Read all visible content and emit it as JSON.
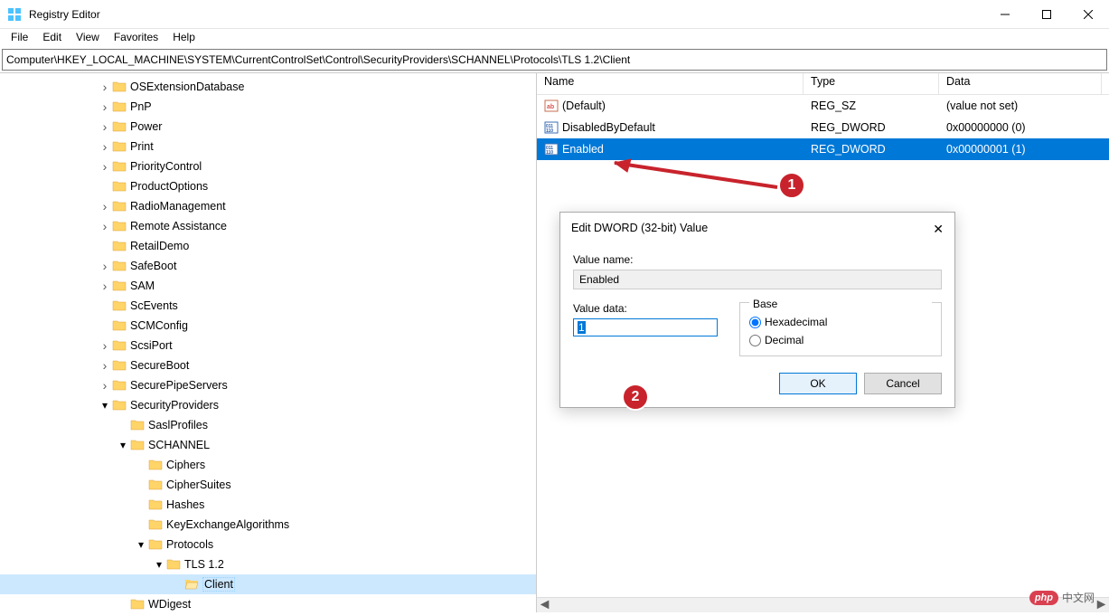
{
  "window": {
    "title": "Registry Editor"
  },
  "menus": [
    "File",
    "Edit",
    "View",
    "Favorites",
    "Help"
  ],
  "address": "Computer\\HKEY_LOCAL_MACHINE\\SYSTEM\\CurrentControlSet\\Control\\SecurityProviders\\SCHANNEL\\Protocols\\TLS 1.2\\Client",
  "tree": {
    "items": [
      {
        "indent": 108,
        "chev": ">",
        "label": "OSExtensionDatabase"
      },
      {
        "indent": 108,
        "chev": ">",
        "label": "PnP"
      },
      {
        "indent": 108,
        "chev": ">",
        "label": "Power"
      },
      {
        "indent": 108,
        "chev": ">",
        "label": "Print"
      },
      {
        "indent": 108,
        "chev": ">",
        "label": "PriorityControl"
      },
      {
        "indent": 108,
        "chev": "",
        "label": "ProductOptions"
      },
      {
        "indent": 108,
        "chev": ">",
        "label": "RadioManagement"
      },
      {
        "indent": 108,
        "chev": ">",
        "label": "Remote Assistance"
      },
      {
        "indent": 108,
        "chev": "",
        "label": "RetailDemo"
      },
      {
        "indent": 108,
        "chev": ">",
        "label": "SafeBoot"
      },
      {
        "indent": 108,
        "chev": ">",
        "label": "SAM"
      },
      {
        "indent": 108,
        "chev": "",
        "label": "ScEvents"
      },
      {
        "indent": 108,
        "chev": "",
        "label": "SCMConfig"
      },
      {
        "indent": 108,
        "chev": ">",
        "label": "ScsiPort"
      },
      {
        "indent": 108,
        "chev": ">",
        "label": "SecureBoot"
      },
      {
        "indent": 108,
        "chev": ">",
        "label": "SecurePipeServers"
      },
      {
        "indent": 108,
        "chev": "v",
        "label": "SecurityProviders"
      },
      {
        "indent": 128,
        "chev": "",
        "label": "SaslProfiles"
      },
      {
        "indent": 128,
        "chev": "v",
        "label": "SCHANNEL"
      },
      {
        "indent": 148,
        "chev": "",
        "label": "Ciphers"
      },
      {
        "indent": 148,
        "chev": "",
        "label": "CipherSuites"
      },
      {
        "indent": 148,
        "chev": "",
        "label": "Hashes"
      },
      {
        "indent": 148,
        "chev": "",
        "label": "KeyExchangeAlgorithms"
      },
      {
        "indent": 148,
        "chev": "v",
        "label": "Protocols"
      },
      {
        "indent": 168,
        "chev": "v",
        "label": "TLS 1.2"
      },
      {
        "indent": 188,
        "chev": "",
        "label": "Client",
        "selected": true,
        "open": true
      },
      {
        "indent": 128,
        "chev": "",
        "label": "WDigest"
      }
    ]
  },
  "list": {
    "headers": {
      "name": "Name",
      "type": "Type",
      "data": "Data"
    },
    "cols": {
      "name": 295,
      "type": 150,
      "data": 180
    },
    "rows": [
      {
        "icon": "sz",
        "name": "(Default)",
        "type": "REG_SZ",
        "data": "(value not set)"
      },
      {
        "icon": "dword",
        "name": "DisabledByDefault",
        "type": "REG_DWORD",
        "data": "0x00000000 (0)"
      },
      {
        "icon": "dword",
        "name": "Enabled",
        "type": "REG_DWORD",
        "data": "0x00000001 (1)",
        "selected": true
      }
    ]
  },
  "dialog": {
    "title": "Edit DWORD (32-bit) Value",
    "valueNameLabel": "Value name:",
    "valueName": "Enabled",
    "valueDataLabel": "Value data:",
    "valueData": "1",
    "baseLabel": "Base",
    "hex": "Hexadecimal",
    "dec": "Decimal",
    "ok": "OK",
    "cancel": "Cancel"
  },
  "annotations": {
    "badge1": "1",
    "badge2": "2"
  },
  "watermark": {
    "php": "php",
    "cn": "中文网"
  }
}
